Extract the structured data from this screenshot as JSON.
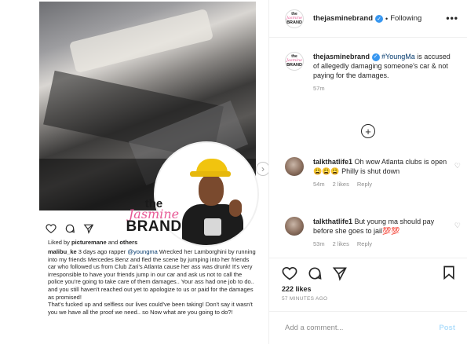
{
  "media": {
    "watermark": {
      "line1": "the",
      "line2": "Jasmine",
      "line3": "BRAND"
    },
    "likes_prefix": "Liked by ",
    "likes_user": "picturemane",
    "likes_and": " and ",
    "likes_others": "others",
    "caption_user": "malibu_ke",
    "caption_pre": " 3 days ago rapper ",
    "caption_mention": "@youngma",
    "caption_body": " Wrecked her Lamborghini by running into my friends Mercedes Benz and fled the scene by jumping into her friends car who followed us from Club Zari's Atlanta cause her ass was drunk! It's very irresponsible to have your friends jump in our car and ask us not to call the police you're going to take care of them damages.. Your ass had one job to do.. and  you still haven't reached out yet to apologize to us or paid for the damages as promised!",
    "caption_body2": "That's fucked up and selfless our lives could've been taking! Don't say it wasn't you we have all the proof we need.. so Now what are you going to do?!"
  },
  "header": {
    "username": "thejasminebrand",
    "separator": "•",
    "follow_label": "Following",
    "more_label": "•••",
    "avatar": {
      "line1": "the",
      "line2": "Jasmine",
      "line3": "BRAND"
    }
  },
  "post_caption": {
    "username": "thejasminebrand",
    "hashtag": "#YoungMa",
    "text": " is accused of allegedly damaging someone's car & not paying for the damages.",
    "time": "57m"
  },
  "load_more_label": "+",
  "comments": [
    {
      "username": "talkthatlife1",
      "text": " Oh wow Atlanta clubs is open😩😩😩 Philly is shut down",
      "time": "54m",
      "likes": "2 likes",
      "reply": "Reply"
    },
    {
      "username": "talkthatlife1",
      "text": " But young ma should pay before she goes to jail💯💯",
      "time": "53m",
      "likes": "2 likes",
      "reply": "Reply"
    }
  ],
  "likes_count": "222 likes",
  "timestamp": "57 MINUTES AGO",
  "add_comment": {
    "placeholder": "Add a comment...",
    "post_label": "Post"
  },
  "colors": {
    "link": "#00376b",
    "verified": "#3897f0",
    "muted": "#8e8e8e",
    "post_disabled": "#b2dffc",
    "brand_pink": "#e85a96"
  },
  "icons": [
    "heart-icon",
    "comment-icon",
    "share-icon",
    "bookmark-icon",
    "verified-badge-icon",
    "chevron-right-icon",
    "plus-circle-icon",
    "more-icon"
  ]
}
